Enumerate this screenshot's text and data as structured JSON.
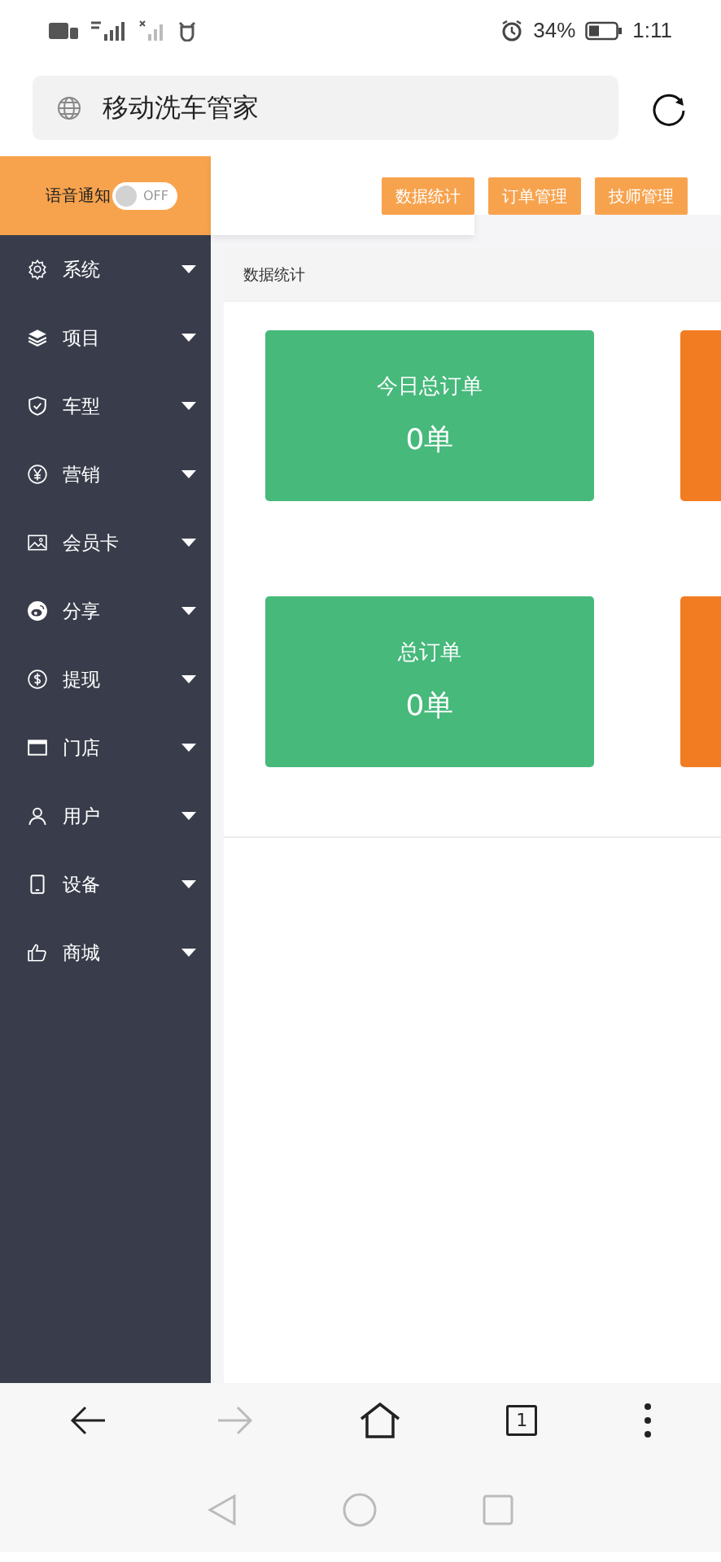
{
  "status_bar": {
    "battery": "34%",
    "time": "1:11"
  },
  "address_bar": {
    "value": "移动洗车管家"
  },
  "header": {
    "voice_label": "语音通知",
    "voice_toggle": {
      "on": false,
      "label": "OFF"
    },
    "buttons": [
      {
        "label": "数据统计"
      },
      {
        "label": "订单管理"
      },
      {
        "label": "技师管理"
      }
    ]
  },
  "sidebar": {
    "items": [
      {
        "label": "系统"
      },
      {
        "label": "项目"
      },
      {
        "label": "车型"
      },
      {
        "label": "营销"
      },
      {
        "label": "会员卡"
      },
      {
        "label": "分享"
      },
      {
        "label": "提现"
      },
      {
        "label": "门店"
      },
      {
        "label": "用户"
      },
      {
        "label": "设备"
      },
      {
        "label": "商城"
      }
    ]
  },
  "panel": {
    "title": "数据统计",
    "card_rows": [
      [
        {
          "title": "今日总订单",
          "value": "0单",
          "color": "#46b97b"
        },
        {
          "color": "#f27c22"
        }
      ],
      [
        {
          "title": "总订单",
          "value": "0单",
          "color": "#46b97b"
        },
        {
          "color": "#f27c22"
        }
      ]
    ]
  },
  "browser_toolbar": {
    "tab_count": "1",
    "forward_disabled": true
  }
}
